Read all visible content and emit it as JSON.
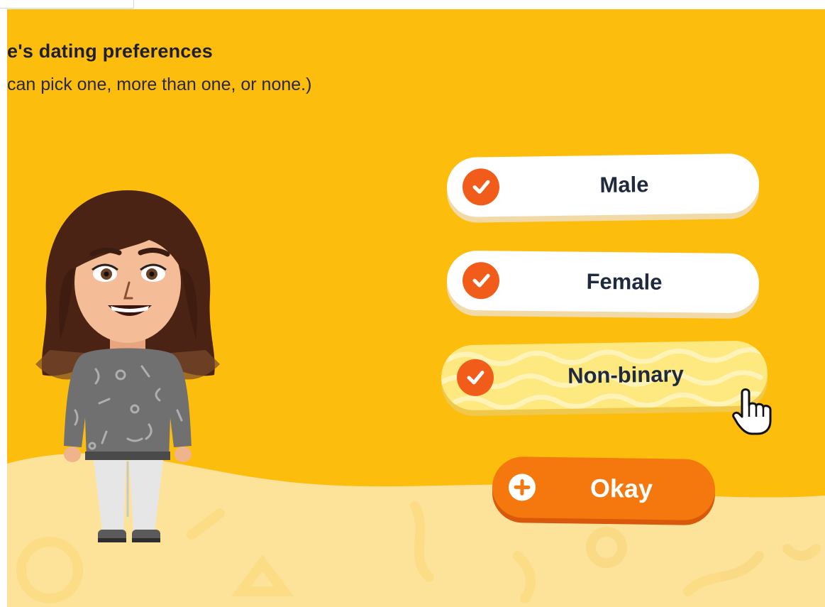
{
  "header": {
    "title": "e's dating preferences",
    "subtitle": "can pick one, more than one, or none.)"
  },
  "options": [
    {
      "label": "Male",
      "checked": true,
      "icon": "checkmark-icon"
    },
    {
      "label": "Female",
      "checked": true,
      "icon": "checkmark-icon"
    },
    {
      "label": "Non-binary",
      "checked": true,
      "icon": "checkmark-icon",
      "hovered": true
    }
  ],
  "okay_button": {
    "label": "Okay",
    "icon": "plus-icon"
  },
  "colors": {
    "background": "#fcbd0d",
    "ground": "#fde39a",
    "accent_orange": "#f5780f",
    "check_orange": "#f25c1b",
    "hover_yellow": "#fde97f",
    "text_dark": "#1f2a3e"
  }
}
